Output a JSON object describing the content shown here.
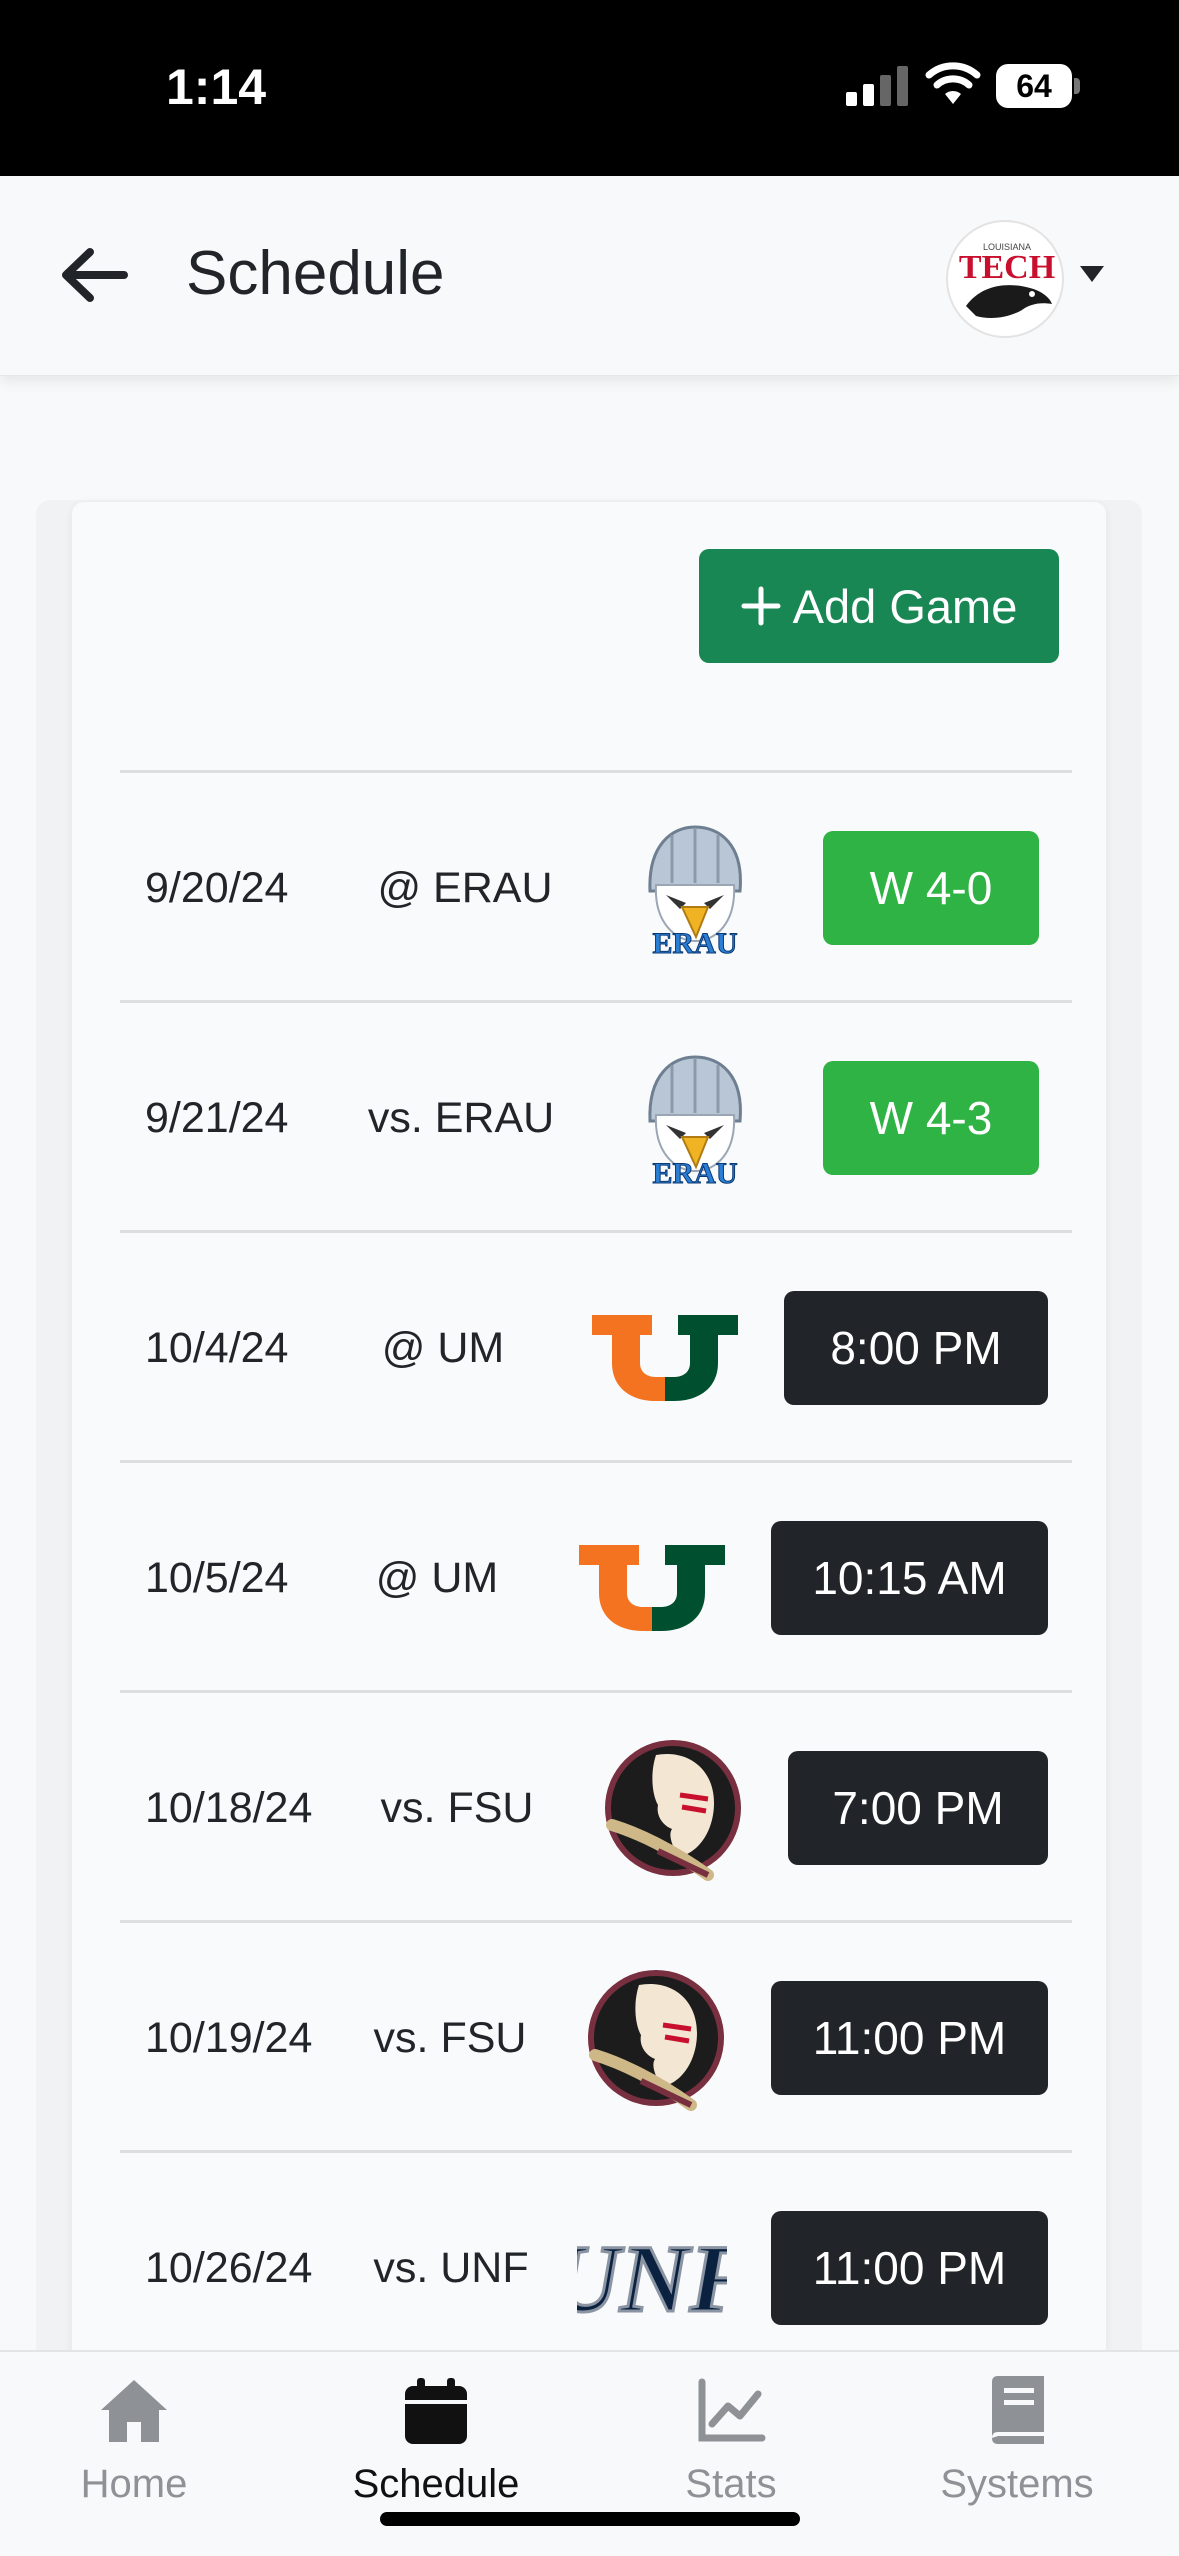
{
  "status_bar": {
    "time": "1:14",
    "battery": "64"
  },
  "header": {
    "title": "Schedule",
    "avatar_icon": "louisiana-tech-bulldog-logo",
    "avatar_label": "TECH"
  },
  "actions": {
    "add_game_label": "Add Game"
  },
  "games": [
    {
      "date": "9/20/24",
      "opponent": "@ ERAU",
      "logo": "erau-eagle-logo",
      "result": "W 4-0",
      "status": "win"
    },
    {
      "date": "9/21/24",
      "opponent": "vs. ERAU",
      "logo": "erau-eagle-logo",
      "result": "W 4-3",
      "status": "win"
    },
    {
      "date": "10/4/24",
      "opponent": "@ UM",
      "logo": "miami-u-logo",
      "result": "8:00 PM",
      "status": "upcoming"
    },
    {
      "date": "10/5/24",
      "opponent": "@ UM",
      "logo": "miami-u-logo",
      "result": "10:15 AM",
      "status": "upcoming"
    },
    {
      "date": "10/18/24",
      "opponent": "vs. FSU",
      "logo": "fsu-seminole-logo",
      "result": "7:00 PM",
      "status": "upcoming"
    },
    {
      "date": "10/19/24",
      "opponent": "vs. FSU",
      "logo": "fsu-seminole-logo",
      "result": "11:00 PM",
      "status": "upcoming"
    },
    {
      "date": "10/26/24",
      "opponent": "vs. UNF",
      "logo": "unf-logo",
      "result": "11:00 PM",
      "status": "upcoming"
    }
  ],
  "tabs": [
    {
      "label": "Home",
      "icon": "home-icon",
      "active": false
    },
    {
      "label": "Schedule",
      "icon": "calendar-icon",
      "active": true
    },
    {
      "label": "Stats",
      "icon": "chart-line-icon",
      "active": false
    },
    {
      "label": "Systems",
      "icon": "book-icon",
      "active": false
    }
  ],
  "colors": {
    "win": "#2fb344",
    "upcoming": "#212529",
    "add_button": "#198754"
  }
}
